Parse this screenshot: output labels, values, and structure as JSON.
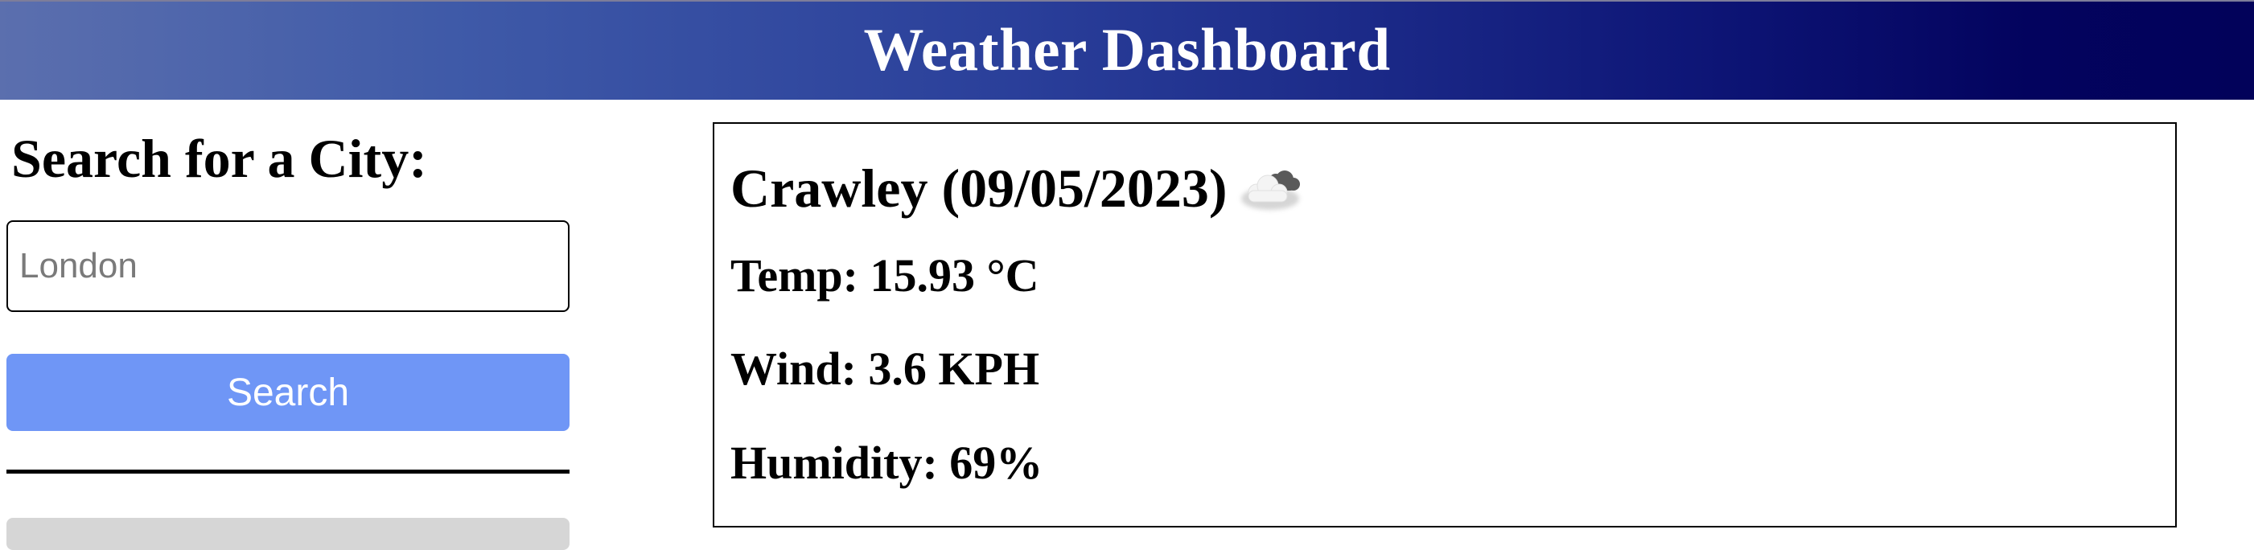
{
  "header": {
    "title": "Weather Dashboard"
  },
  "sidebar": {
    "search_heading": "Search for a City:",
    "search_placeholder": "London",
    "search_value": "",
    "search_button_label": "Search"
  },
  "current": {
    "city_date": "Crawley (09/05/2023)",
    "icon": "cloud-icon",
    "temp": "Temp: 15.93 °C",
    "wind": "Wind: 3.6 KPH",
    "humidity": "Humidity: 69%"
  },
  "colors": {
    "header_gradient_start": "#5b6fae",
    "header_gradient_end": "#02025a",
    "search_button": "#6f96f6",
    "history_button": "#d6d6d6"
  }
}
